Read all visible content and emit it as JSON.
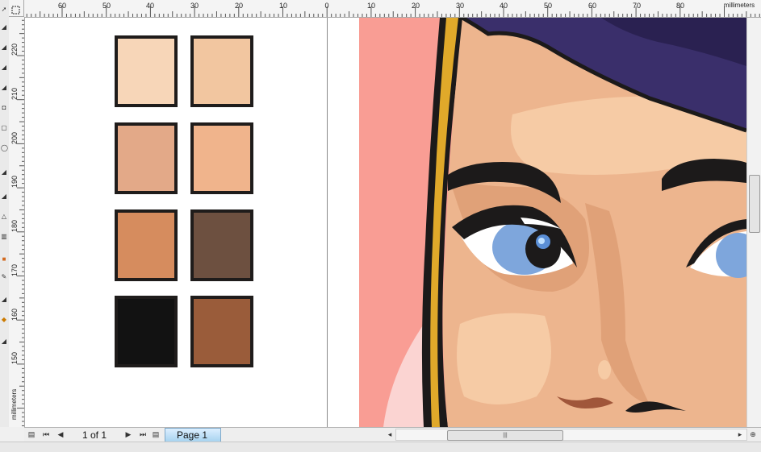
{
  "rulers": {
    "unit": "millimeters",
    "horizontal_labels": [
      "60",
      "50",
      "40",
      "30",
      "20",
      "10",
      "0",
      "10",
      "20",
      "30",
      "40",
      "50",
      "60",
      "70",
      "80"
    ],
    "vertical_labels": [
      "220",
      "210",
      "200",
      "190",
      "180",
      "170",
      "160",
      "150"
    ]
  },
  "swatches": [
    {
      "name": "skin-lightest",
      "color": "#f7d6b8"
    },
    {
      "name": "skin-light-peach",
      "color": "#f2c6a0"
    },
    {
      "name": "skin-light-tan",
      "color": "#e3a988"
    },
    {
      "name": "skin-peach",
      "color": "#f0b48c"
    },
    {
      "name": "skin-medium",
      "color": "#d68c5e"
    },
    {
      "name": "skin-dark-brown",
      "color": "#6d5040"
    },
    {
      "name": "black",
      "color": "#121212"
    },
    {
      "name": "skin-brown",
      "color": "#9a5c3a"
    }
  ],
  "colors": {
    "background_pink": "#f99d94",
    "skin_base": "#edb58e",
    "skin_highlight": "#f6cba5",
    "skin_shadow": "#e0a178",
    "hair": "#3a2f6b",
    "hair_dark": "#2a2151",
    "outline": "#1c1a1a",
    "gold": "#e0a92a",
    "iris": "#7ea6dc"
  },
  "navigation": {
    "page_counter": "1 of 1",
    "page_tab": "Page 1"
  },
  "scrollbar": {
    "thumb_grip": "|||"
  }
}
